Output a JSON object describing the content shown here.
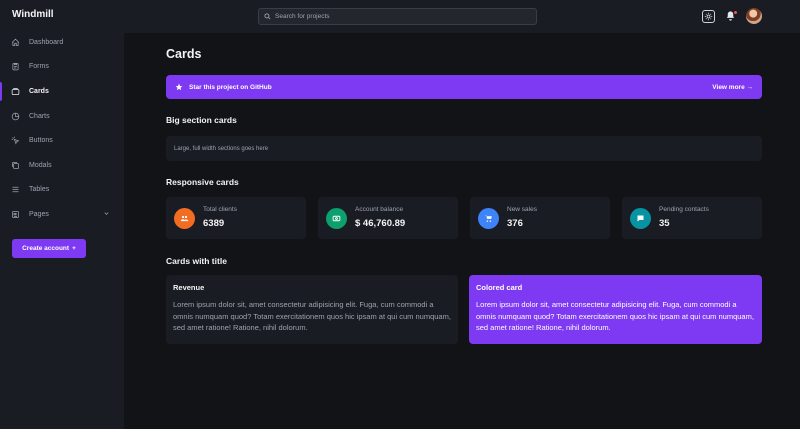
{
  "app": {
    "brand": "Windmill"
  },
  "sidebar": {
    "items": [
      {
        "label": "Dashboard",
        "icon": "home-icon"
      },
      {
        "label": "Forms",
        "icon": "clipboard-icon"
      },
      {
        "label": "Cards",
        "icon": "cards-icon",
        "active": true
      },
      {
        "label": "Charts",
        "icon": "pie-chart-icon"
      },
      {
        "label": "Buttons",
        "icon": "cursor-click-icon"
      },
      {
        "label": "Modals",
        "icon": "modal-icon"
      },
      {
        "label": "Tables",
        "icon": "table-icon"
      },
      {
        "label": "Pages",
        "icon": "pages-icon",
        "expandable": true
      }
    ],
    "create_account": "Create account",
    "create_account_symbol": "+"
  },
  "header": {
    "search_placeholder": "Search for projects"
  },
  "main": {
    "title": "Cards",
    "banner": {
      "text": "Star this project on GitHub",
      "link": "View more →"
    },
    "big_section": {
      "title": "Big section cards",
      "text": "Large, full width sections goes here"
    },
    "responsive": {
      "title": "Responsive cards",
      "cards": [
        {
          "label": "Total clients",
          "value": "6389",
          "color": "#f26c22",
          "icon": "users-icon"
        },
        {
          "label": "Account balance",
          "value": "$ 46,760.89",
          "color": "#0e9f6e",
          "icon": "cash-icon"
        },
        {
          "label": "New sales",
          "value": "376",
          "color": "#3f83f8",
          "icon": "cart-icon"
        },
        {
          "label": "Pending contacts",
          "value": "35",
          "color": "#0694a2",
          "icon": "chat-icon"
        }
      ]
    },
    "with_title": {
      "title": "Cards with title",
      "revenue": {
        "title": "Revenue",
        "body": "Lorem ipsum dolor sit, amet consectetur adipisicing elit. Fuga, cum commodi a omnis numquam quod? Totam exercitationem quos hic ipsam at qui cum numquam, sed amet ratione! Ratione, nihil dolorum."
      },
      "colored": {
        "title": "Colored card",
        "body": "Lorem ipsum dolor sit, amet consectetur adipisicing elit. Fuga, cum commodi a omnis numquam quod? Totam exercitationem quos hic ipsam at qui cum numquam, sed amet ratione! Ratione, nihil dolorum."
      }
    }
  },
  "colors": {
    "accent": "#7e3af2",
    "sidebar_bg": "#1a1c23",
    "page_bg": "#121317"
  }
}
